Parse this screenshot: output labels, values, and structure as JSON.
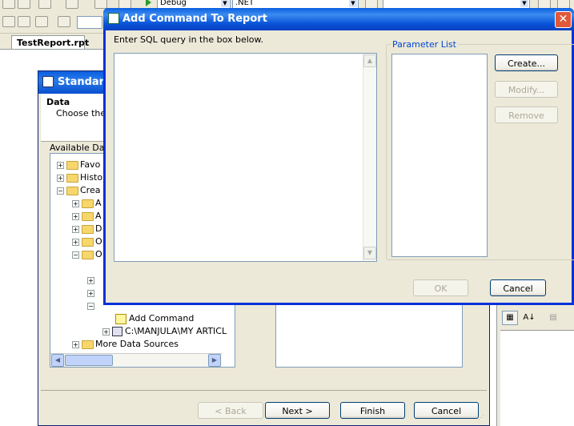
{
  "ide": {
    "doc_tab": "TestReport.rpt",
    "config_combo": "Debug",
    "platform_combo": ".NET"
  },
  "standard_report": {
    "title": "Standard",
    "section_title": "Data",
    "section_desc": "Choose the",
    "available_label": "Available Data",
    "tree": [
      {
        "label": "Favo",
        "indent": 0,
        "expander": "+",
        "icon": "folder"
      },
      {
        "label": "Histo",
        "indent": 0,
        "expander": "+",
        "icon": "folder"
      },
      {
        "label": "Crea",
        "indent": 0,
        "expander": "-",
        "icon": "folder"
      },
      {
        "label": "A",
        "indent": 1,
        "expander": "+",
        "icon": "folder"
      },
      {
        "label": "A",
        "indent": 1,
        "expander": "+",
        "icon": "folder"
      },
      {
        "label": "D",
        "indent": 1,
        "expander": "+",
        "icon": "folder"
      },
      {
        "label": "O",
        "indent": 1,
        "expander": "+",
        "icon": "folder"
      },
      {
        "label": "O",
        "indent": 1,
        "expander": "-",
        "icon": "folder"
      }
    ],
    "tree_lower": [
      {
        "label": "Add Command",
        "icon": "command"
      },
      {
        "label": "C:\\MANJULA\\MY ARTICL",
        "icon": "database"
      },
      {
        "label": "More Data Sources",
        "icon": "folder"
      }
    ],
    "buttons": {
      "back": "< Back",
      "next": "Next >",
      "finish": "Finish",
      "cancel": "Cancel"
    }
  },
  "dialog": {
    "title": "Add Command To Report",
    "close_glyph": "✕",
    "sql_label": "Enter SQL query in the box below.",
    "sql_value": "",
    "param_legend": "Parameter List",
    "buttons": {
      "create": "Create...",
      "modify": "Modify...",
      "remove": "Remove",
      "ok": "OK",
      "cancel": "Cancel"
    }
  }
}
